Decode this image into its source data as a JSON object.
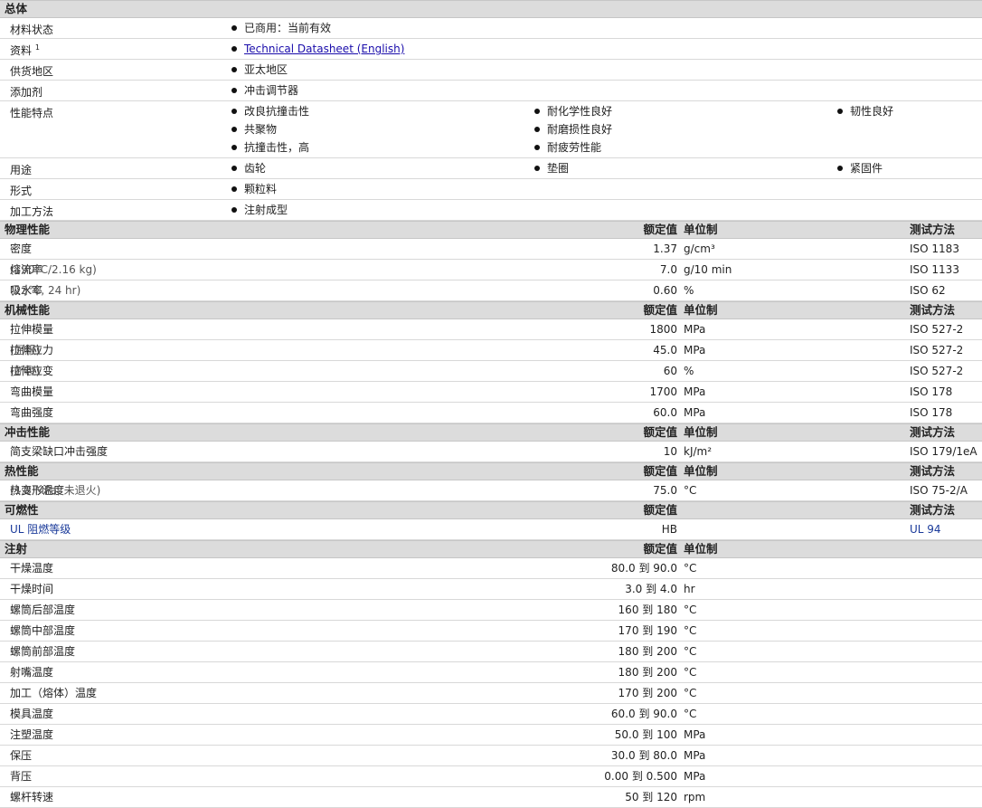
{
  "general": {
    "title": "总体",
    "material_status": {
      "label": "材料状态",
      "value": "已商用：当前有效"
    },
    "docs": {
      "label": "资料",
      "sup": "1",
      "link": "Technical Datasheet (English)"
    },
    "region": {
      "label": "供货地区",
      "value": "亚太地区"
    },
    "additive": {
      "label": "添加剂",
      "value": "冲击调节器"
    },
    "features": {
      "label": "性能特点",
      "col1": [
        "改良抗撞击性",
        "共聚物",
        "抗撞击性，高"
      ],
      "col2": [
        "耐化学性良好",
        "耐磨损性良好",
        "耐疲劳性能"
      ],
      "col3": [
        "韧性良好"
      ]
    },
    "uses": {
      "label": "用途",
      "col1": [
        "齿轮"
      ],
      "col2": [
        "垫圈"
      ],
      "col3": [
        "紧固件"
      ]
    },
    "form": {
      "label": "形式",
      "value": "颗粒料"
    },
    "processing": {
      "label": "加工方法",
      "value": "注射成型"
    }
  },
  "headers": {
    "value": "额定值",
    "unit": "单位制",
    "method": "测试方法"
  },
  "physical": {
    "title": "物理性能",
    "rows": [
      {
        "name": "密度",
        "cond": "",
        "value": "1.37",
        "unit": "g/cm³",
        "method": "ISO 1183"
      },
      {
        "name": "熔流率",
        "cond": "(190°C/2.16 kg)",
        "value": "7.0",
        "unit": "g/10 min",
        "method": "ISO 1133"
      },
      {
        "name": "吸水率",
        "cond": "(23°C, 24 hr)",
        "value": "0.60",
        "unit": "%",
        "method": "ISO 62"
      }
    ]
  },
  "mechanical": {
    "title": "机械性能",
    "rows": [
      {
        "name": "拉伸模量",
        "cond": "",
        "value": "1800",
        "unit": "MPa",
        "method": "ISO 527-2"
      },
      {
        "name": "拉伸应力",
        "cond": "(屈服)",
        "value": "45.0",
        "unit": "MPa",
        "method": "ISO 527-2"
      },
      {
        "name": "拉伸应变",
        "cond": "(断裂)",
        "value": "60",
        "unit": "%",
        "method": "ISO 527-2"
      },
      {
        "name": "弯曲模量",
        "cond": "",
        "value": "1700",
        "unit": "MPa",
        "method": "ISO 178"
      },
      {
        "name": "弯曲强度",
        "cond": "",
        "value": "60.0",
        "unit": "MPa",
        "method": "ISO 178"
      }
    ]
  },
  "impact": {
    "title": "冲击性能",
    "rows": [
      {
        "name": "简支梁缺口冲击强度",
        "cond": "",
        "value": "10",
        "unit": "kJ/m²",
        "method": "ISO 179/1eA"
      }
    ]
  },
  "thermal": {
    "title": "热性能",
    "rows": [
      {
        "name": "热变形温度",
        "cond": "(1.8 MPa, 未退火)",
        "value": "75.0",
        "unit": "°C",
        "method": "ISO 75-2/A"
      }
    ]
  },
  "flammability": {
    "title": "可燃性",
    "rows": [
      {
        "name": "UL 阻燃等级",
        "cond": "",
        "value": "HB",
        "unit": "",
        "method": "UL 94"
      }
    ]
  },
  "injection": {
    "title": "注射",
    "rows": [
      {
        "name": "干燥温度",
        "value": "80.0 到  90.0",
        "unit": "°C"
      },
      {
        "name": "干燥时间",
        "value": "3.0 到  4.0",
        "unit": "hr"
      },
      {
        "name": "螺筒后部温度",
        "value": "160 到  180",
        "unit": "°C"
      },
      {
        "name": "螺筒中部温度",
        "value": "170 到  190",
        "unit": "°C"
      },
      {
        "name": "螺筒前部温度",
        "value": "180 到  200",
        "unit": "°C"
      },
      {
        "name": "射嘴温度",
        "value": "180 到  200",
        "unit": "°C"
      },
      {
        "name": "加工（熔体）温度",
        "value": "170 到  200",
        "unit": "°C"
      },
      {
        "name": "模具温度",
        "value": "60.0 到  90.0",
        "unit": "°C"
      },
      {
        "name": "注塑温度",
        "value": "50.0 到  100",
        "unit": "MPa"
      },
      {
        "name": "保压",
        "value": "30.0 到  80.0",
        "unit": "MPa"
      },
      {
        "name": "背压",
        "value": "0.00 到  0.500",
        "unit": "MPa"
      },
      {
        "name": "螺杆转速",
        "value": "50 到  120",
        "unit": "rpm"
      }
    ]
  }
}
